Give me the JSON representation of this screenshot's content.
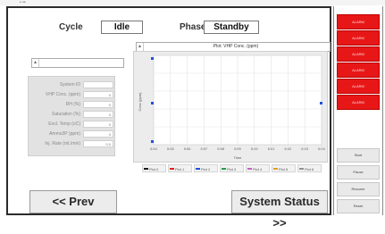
{
  "window": {
    "title_dots": "• ••"
  },
  "header": {
    "cycle_label": "Cycle",
    "cycle_value": "Idle",
    "phase_label": "Phase",
    "phase_value": "Standby"
  },
  "left": {
    "top_combo": "",
    "fields": [
      {
        "label": "System ID",
        "value": ""
      },
      {
        "label": "VHP Conc. (ppm)",
        "value": "0"
      },
      {
        "label": "RH (%)",
        "value": "0"
      },
      {
        "label": "Saturation (%)",
        "value": "0"
      },
      {
        "label": "Encl. Temp (oC)",
        "value": "0"
      },
      {
        "label": "Ammo3P (ppm)",
        "value": "0"
      },
      {
        "label": "Inj. Rate (mL/min)",
        "value": "0.0"
      }
    ]
  },
  "plot": {
    "selector_label": "Plot: VHP Conc. (ppm)",
    "x_ticks": [
      "5:54",
      "5:55",
      "5:56",
      "5:57",
      "5:58",
      "5:59",
      "6:00",
      "6:01",
      "6:02",
      "6:03",
      "6:04"
    ],
    "xlabel": "Time",
    "ylabel": "Conc (ppm)",
    "legend": [
      {
        "label": "Plot 0",
        "color": "#1a1a1a"
      },
      {
        "label": "Plot 1",
        "color": "#e02020"
      },
      {
        "label": "Plot 2",
        "color": "#2050e0"
      },
      {
        "label": "Plot 3",
        "color": "#20a040"
      },
      {
        "label": "Plot 4",
        "color": "#c060c0"
      },
      {
        "label": "Plot 5",
        "color": "#e0a020"
      },
      {
        "label": "Plot 6",
        "color": "#909090"
      }
    ]
  },
  "nav": {
    "prev": "<< Prev",
    "next": "System Status >>"
  },
  "right_panel": {
    "red_buttons": [
      "ALARM",
      "ALARM",
      "ALARM",
      "ALARM",
      "ALARM",
      "ALARM"
    ],
    "gray_buttons": [
      "Start",
      "Pause",
      "Resume",
      "Reset"
    ]
  },
  "colors": {
    "alarm": "#e81717",
    "frame": "#2b2b2b"
  }
}
